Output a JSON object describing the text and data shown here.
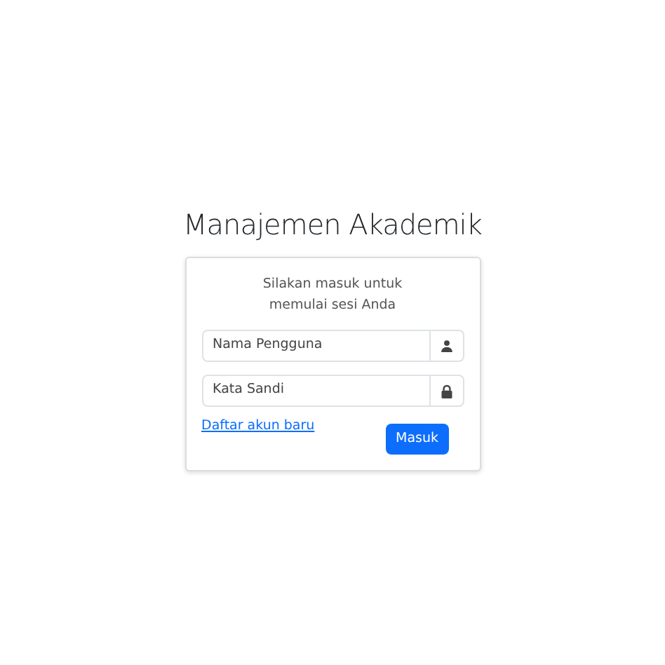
{
  "title": "Manajemen Akademik",
  "card": {
    "message": "Silakan masuk untuk memulai sesi Anda",
    "fields": [
      {
        "kind": "user",
        "placeholder": "Nama Pengguna"
      },
      {
        "kind": "password",
        "placeholder": "Kata Sandi"
      }
    ],
    "register_link": "Daftar akun baru",
    "submit": "Masuk"
  }
}
